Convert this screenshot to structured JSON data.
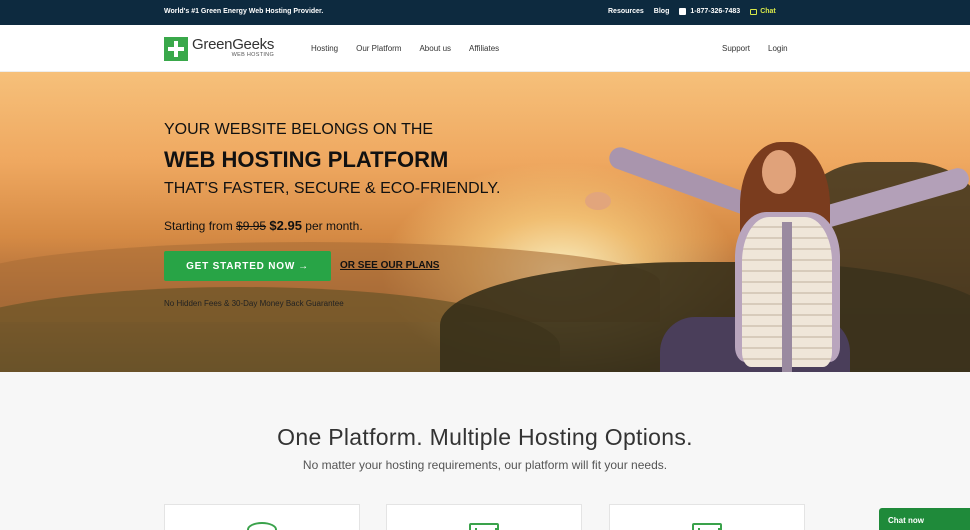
{
  "topbar": {
    "tagline": "World's #1 Green Energy Web Hosting Provider.",
    "links": [
      "Resources",
      "Blog"
    ],
    "phone": "1-877-326-7483",
    "chat": "Chat"
  },
  "nav": {
    "logo_name": "GreenGeeks",
    "logo_sub": "WEB HOSTING",
    "menu": [
      "Hosting",
      "Our Platform",
      "About us",
      "Affiliates"
    ],
    "right": [
      "Support",
      "Login"
    ]
  },
  "hero": {
    "line1": "YOUR WEBSITE BELONGS ON THE",
    "line2": "WEB HOSTING PLATFORM",
    "line3": "THAT'S FASTER, SECURE & ECO-FRIENDLY.",
    "price_prefix": "Starting from ",
    "price_old": "$9.95",
    "price_new": "$2.95",
    "price_suffix": " per month.",
    "cta_label": "GET STARTED NOW",
    "cta_arrow": "→",
    "plans_label": "OR SEE OUR PLANS",
    "guarantee": "No Hidden Fees & 30-Day Money Back Guarantee"
  },
  "section": {
    "title": "One Platform. Multiple Hosting Options.",
    "subtitle": "No matter your hosting requirements, our platform will fit your needs.",
    "cards": [
      {
        "icon": "globe-icon"
      },
      {
        "icon": "server-icon"
      },
      {
        "icon": "server-icon"
      }
    ]
  },
  "chat_widget": {
    "label": "Chat now"
  },
  "colors": {
    "brand": "#39a84a",
    "topbar": "#0d2a3f",
    "cta": "#28a446"
  }
}
